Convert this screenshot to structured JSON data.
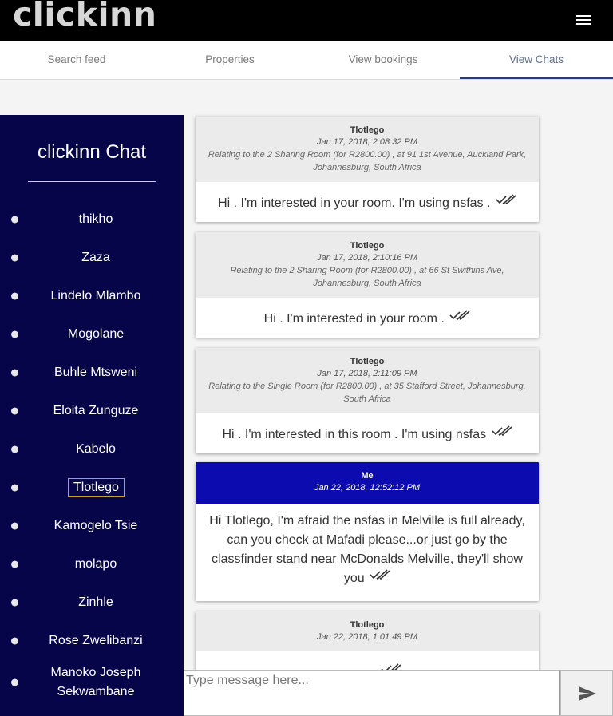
{
  "app": {
    "brand": "clickinn"
  },
  "tabs": [
    {
      "label": "Search feed",
      "active": false
    },
    {
      "label": "Properties",
      "active": false
    },
    {
      "label": "View bookings",
      "active": false
    },
    {
      "label": "View Chats",
      "active": true
    }
  ],
  "sidebar": {
    "title": "clickinn Chat",
    "contacts": [
      {
        "name": "thikho"
      },
      {
        "name": "Zaza"
      },
      {
        "name": "Lindelo Mlambo"
      },
      {
        "name": "Mogolane"
      },
      {
        "name": "Buhle Mtsweni"
      },
      {
        "name": "Eloita Zunguze"
      },
      {
        "name": "Kabelo"
      },
      {
        "name": "Tlotlego",
        "selected": true
      },
      {
        "name": "Kamogelo Tsie"
      },
      {
        "name": "molapo"
      },
      {
        "name": "Zinhle"
      },
      {
        "name": "Rose Zwelibanzi"
      },
      {
        "name": "Manoko Joseph Sekwambane"
      }
    ]
  },
  "messages": [
    {
      "sender": "Tlotlego",
      "time": "Jan 17, 2018, 2:08:32 PM",
      "context": "Relating to the 2 Sharing Room (for R2800.00) , at 91 1st Avenue, Auckland Park, Johannesburg, South Africa",
      "text": "Hi . I'm interested in your room. I'm using nsfas ."
    },
    {
      "sender": "Tlotlego",
      "time": "Jan 17, 2018, 2:10:16 PM",
      "context": "Relating to the 2 Sharing Room (for R2800.00) , at 66 St Swithins Ave, Johannesburg, South Africa",
      "text": "Hi . I'm interested in your room ."
    },
    {
      "sender": "Tlotlego",
      "time": "Jan 17, 2018, 2:11:09 PM",
      "context": "Relating to the Single Room (for R2800.00) , at 35 Stafford Street, Johannesburg, South Africa",
      "text": "Hi . I'm interested in this room . I'm using nsfas"
    },
    {
      "sender": "Me",
      "time": "Jan 22, 2018, 12:52:12 PM",
      "context": "",
      "text": "Hi Tlotlego, I'm afraid the nsfas in Melville is full already, can you check at Mafadi please...or just go by the classfinder stand near McDonalds Melville, they'll show you"
    },
    {
      "sender": "Tlotlego",
      "time": "Jan 22, 2018, 1:01:49 PM",
      "context": "",
      "text": ""
    }
  ],
  "compose": {
    "placeholder": "Type message here..."
  },
  "icons": {
    "menu": "menu-icon",
    "read": "double-check-icon",
    "send": "send-icon"
  },
  "colors": {
    "appbar": "#000000",
    "sidebar": "#06054a",
    "my_message_header": "#0b0bb0",
    "selected_outline": "#c9a227"
  }
}
